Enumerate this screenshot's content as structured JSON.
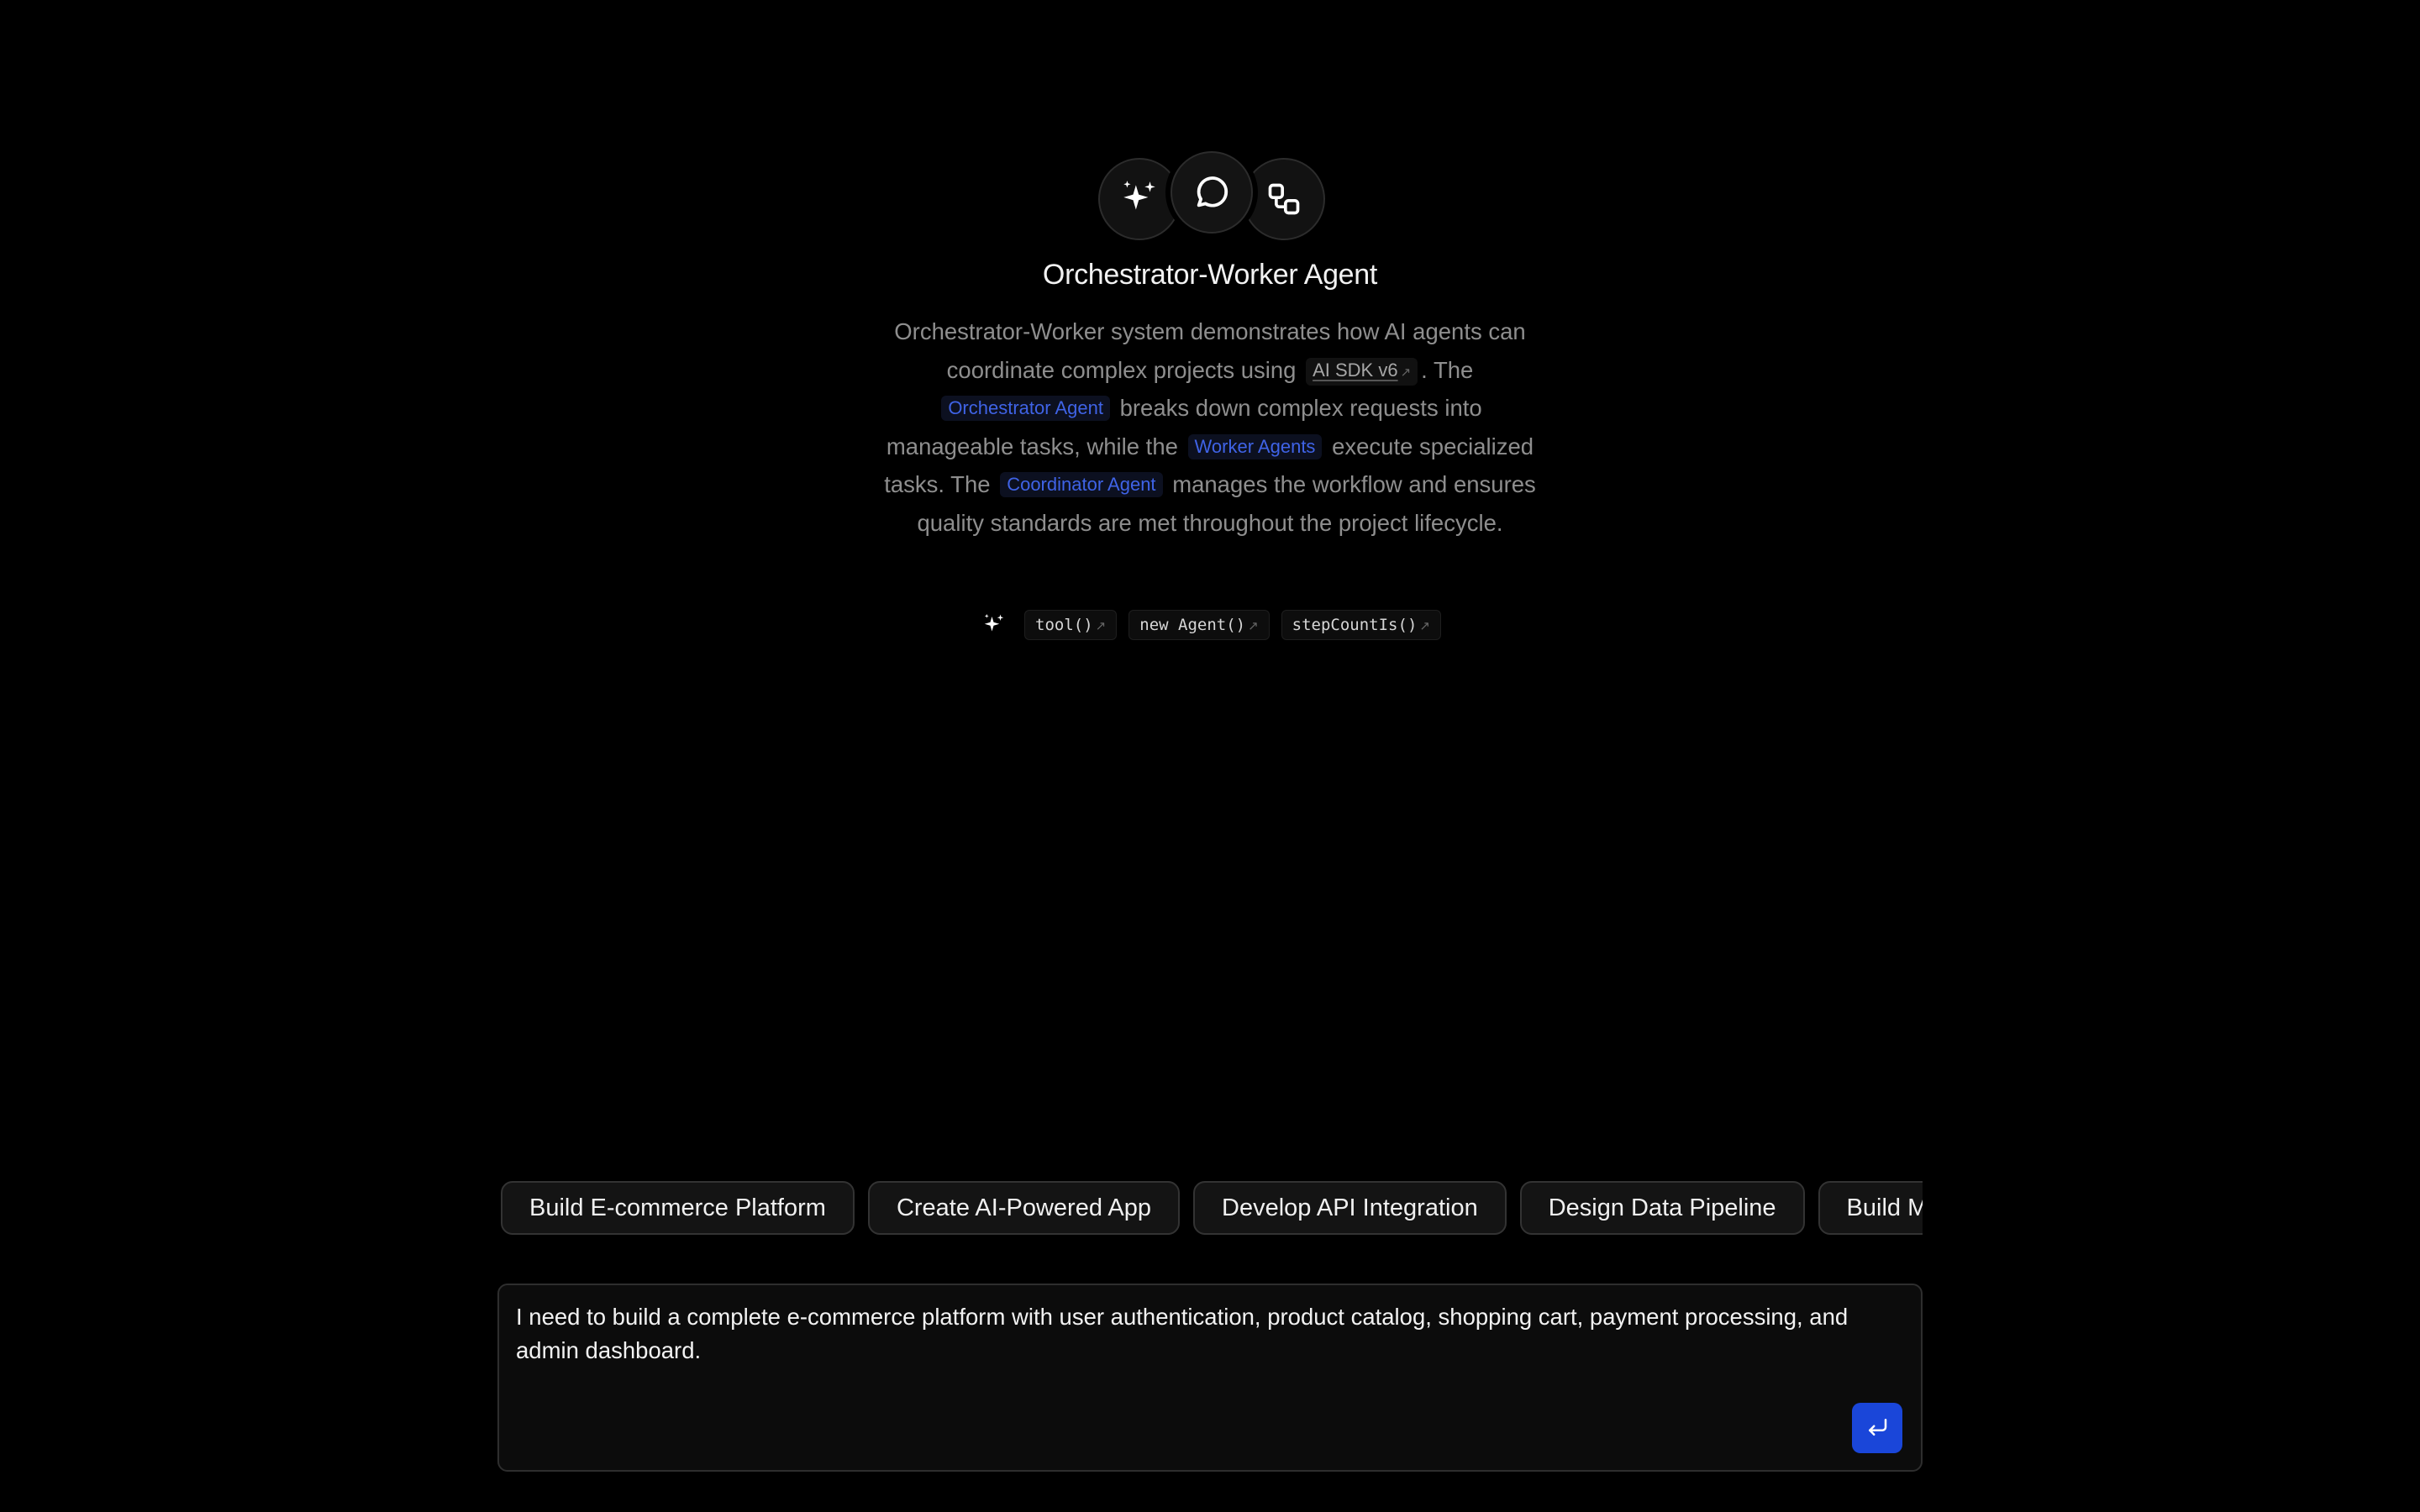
{
  "hero": {
    "icons": [
      "sparkles-icon",
      "chat-bubble-icon",
      "workflow-icon"
    ],
    "title": "Orchestrator-Worker Agent",
    "description": {
      "part1": "Orchestrator-Worker system demonstrates how AI agents can coordinate complex projects using",
      "sdk_link": "AI SDK v6",
      "part2": ". The",
      "orchestrator": "Orchestrator Agent",
      "part3": "breaks down complex requests into manageable tasks, while the",
      "workers": "Worker Agents",
      "part4": "execute specialized tasks. The",
      "coordinator": "Coordinator Agent",
      "part5": "manages the workflow and ensures quality standards are met throughout the project lifecycle."
    },
    "tools": [
      "tool()",
      "new Agent()",
      "stepCountIs()"
    ]
  },
  "suggestions": [
    "Build E-commerce Platform",
    "Create AI-Powered App",
    "Develop API Integration",
    "Design Data Pipeline",
    "Build Microservices"
  ],
  "composer": {
    "value": "I need to build a complete e-commerce platform with user authentication, product catalog, shopping cart, payment processing, and admin dashboard.",
    "send_icon": "enter-return-icon"
  },
  "colors": {
    "background": "#000000",
    "accent": "#1a46d9",
    "link_blue": "#3f63e6",
    "muted_text": "#8e8e8e"
  }
}
